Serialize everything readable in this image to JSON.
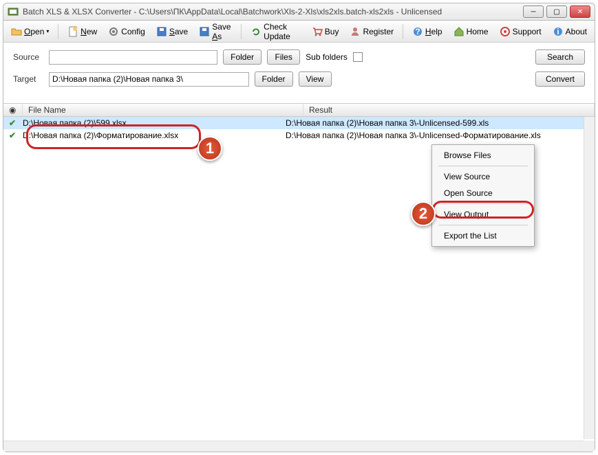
{
  "window": {
    "title": "Batch XLS & XLSX Converter - C:\\Users\\ПК\\AppData\\Local\\Batchwork\\Xls-2-Xls\\xls2xls.batch-xls2xls - Unlicensed"
  },
  "toolbar": {
    "open": "Open",
    "new": "New",
    "config": "Config",
    "save": "Save",
    "save_as": "Save As",
    "check_update": "Check Update",
    "buy": "Buy",
    "register": "Register",
    "help": "Help",
    "home": "Home",
    "support": "Support",
    "about": "About"
  },
  "form": {
    "source_label": "Source",
    "source_value": "",
    "target_label": "Target",
    "target_value": "D:\\Новая папка (2)\\Новая папка 3\\",
    "folder_btn": "Folder",
    "files_btn": "Files",
    "subfolders_label": "Sub folders",
    "search_btn": "Search",
    "view_btn": "View",
    "convert_btn": "Convert"
  },
  "grid": {
    "header_filename": "File Name",
    "header_result": "Result",
    "rows": [
      {
        "file": "D:\\Новая папка (2)\\599.xlsx",
        "result": "D:\\Новая папка (2)\\Новая папка 3\\-Unlicensed-599.xls"
      },
      {
        "file": "D:\\Новая папка (2)\\Форматирование.xlsx",
        "result": "D:\\Новая папка (2)\\Новая папка 3\\-Unlicensed-Форматирование.xls"
      }
    ]
  },
  "context_menu": {
    "browse": "Browse Files",
    "view_source": "View  Source",
    "open_source": "Open Source",
    "view_output": "View  Output",
    "export": "Export the List"
  },
  "badges": {
    "one": "1",
    "two": "2"
  }
}
